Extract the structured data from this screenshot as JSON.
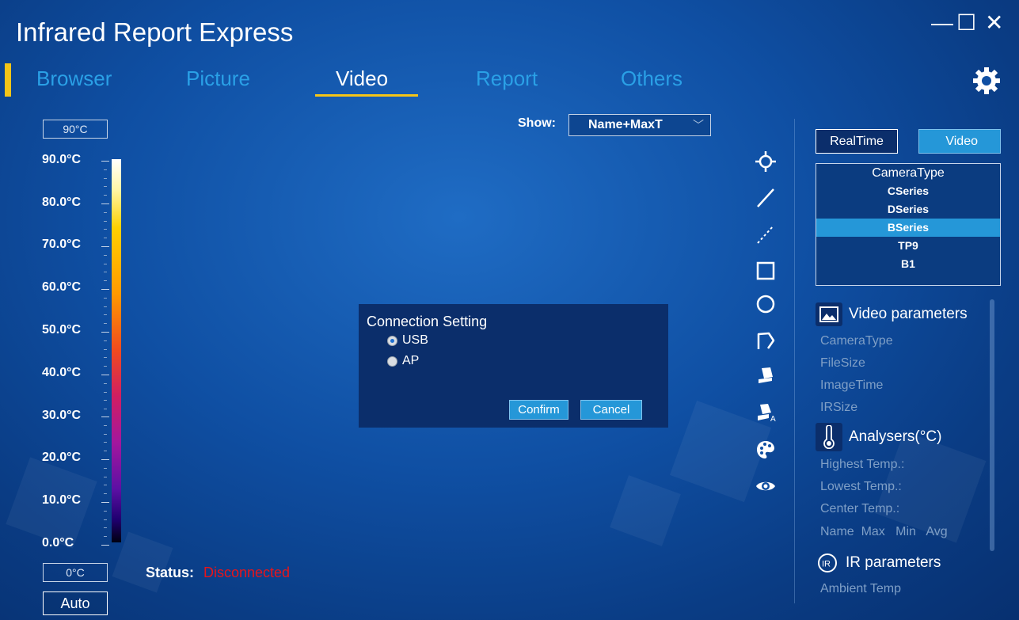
{
  "app": {
    "title": "Infrared Report Express"
  },
  "window": {
    "minimize": "—",
    "maximize": "☐",
    "close": "✕"
  },
  "tabs": [
    {
      "label": "Browser"
    },
    {
      "label": "Picture"
    },
    {
      "label": "Video",
      "active": true
    },
    {
      "label": "Report"
    },
    {
      "label": "Others"
    }
  ],
  "scale": {
    "max_box": "90°C",
    "min_box": "0°C",
    "labels": [
      "90.0°C",
      "80.0°C",
      "70.0°C",
      "60.0°C",
      "50.0°C",
      "40.0°C",
      "30.0°C",
      "20.0°C",
      "10.0°C",
      "0.0°C"
    ],
    "auto_label": "Auto"
  },
  "status": {
    "label": "Status:",
    "value": "Disconnected",
    "value_color": "#e8141a"
  },
  "show": {
    "label": "Show:",
    "value": "Name+MaxT",
    "chevron": "﹀"
  },
  "dialog": {
    "title": "Connection Setting",
    "options": [
      {
        "label": "USB",
        "selected": true
      },
      {
        "label": "AP",
        "selected": false
      }
    ],
    "confirm": "Confirm",
    "cancel": "Cancel"
  },
  "toolbar_icons": [
    "crosshair-icon",
    "line-icon",
    "dashed-line-icon",
    "rectangle-icon",
    "circle-icon",
    "polygon-icon",
    "eraser-icon",
    "eraser-text-icon",
    "palette-icon",
    "eye-icon"
  ],
  "right_panel": {
    "realtime_label": "RealTime",
    "video_label": "Video",
    "camera_header": "CameraType",
    "cameras": [
      "CSeries",
      "DSeries",
      "BSeries",
      "TP9",
      "B1"
    ],
    "selected_camera": "BSeries",
    "video_params": {
      "title": "Video parameters",
      "items": [
        "CameraType",
        "FileSize",
        "ImageTime",
        "IRSize"
      ]
    },
    "analysers": {
      "title": "Analysers(°C)",
      "items": [
        "Highest Temp.:",
        "Lowest Temp.:",
        "Center Temp.:"
      ],
      "columns": "Name  Max   Min   Avg"
    },
    "ir_params": {
      "title": "IR parameters",
      "items": [
        "Ambient Temp"
      ]
    }
  },
  "colors": {
    "accent": "#f5c518",
    "tab_inactive": "#2aa0e6",
    "button": "#2597d8",
    "dialog": "#0b2e6b"
  }
}
